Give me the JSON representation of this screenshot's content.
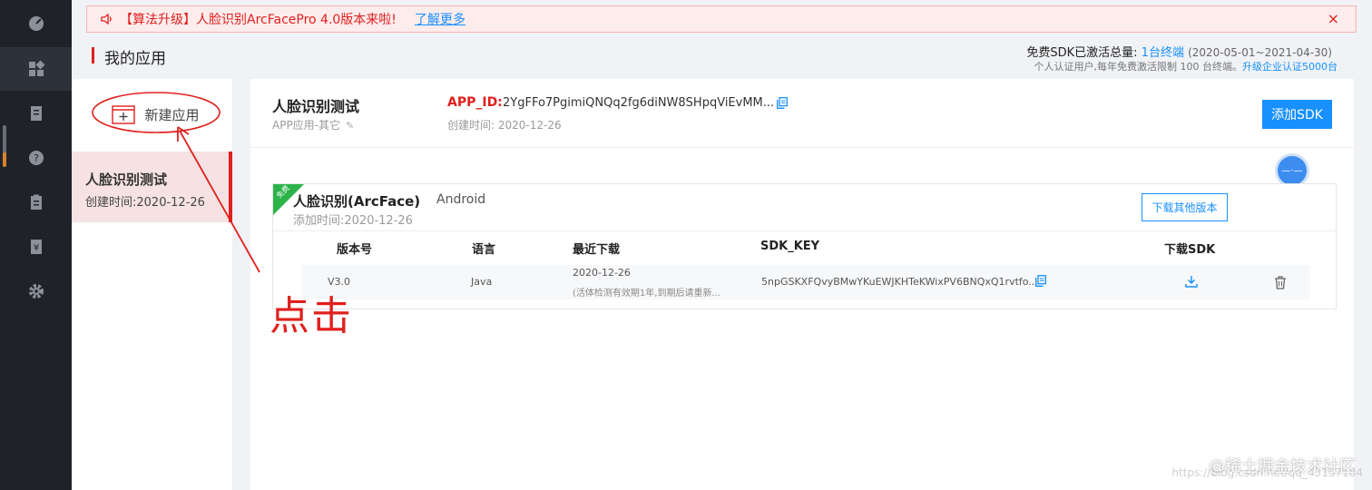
{
  "banner": {
    "text": "【算法升级】人脸识别ArcFacePro 4.0版本来啦!",
    "link": "了解更多",
    "close": "×"
  },
  "header": {
    "title": "我的应用",
    "quota_label": "免费SDK已激活总量:",
    "quota_count": "1台终端",
    "quota_range": "(2020-05-01~2021-04-30)",
    "quota_note": "个人认证用户,每年免费激活限制 100 台终端。",
    "upgrade_link": "升级企业认证5000台"
  },
  "sidebar": {
    "new_app": "新建应用",
    "apps": [
      {
        "name": "人脸识别测试",
        "created": "创建时间:2020-12-26"
      }
    ]
  },
  "app": {
    "name": "人脸识别测试",
    "type": "APP应用-其它",
    "appid_label": "APP_ID:",
    "appid_value": "2YgFFo7PgimiQNQq2fg6diNW8SHpqViEvMM...",
    "created": "创建时间: 2020-12-26",
    "add_sdk": "添加SDK"
  },
  "sdk": {
    "ribbon": "免费",
    "name": "人脸识别(ArcFace)",
    "platform": "Android",
    "added": "添加时间:2020-12-26",
    "download_other": "下载其他版本",
    "columns": [
      "版本号",
      "语言",
      "最近下载",
      "SDK_KEY",
      "下载SDK"
    ],
    "rows": [
      {
        "version": "V3.0",
        "language": "Java",
        "last_download": "2020-12-26",
        "last_download_note": "(活体检测有效期1年,到期后请重新...",
        "sdk_key": "5npGSKXFQvyBMwYKuEWJKHTeKWixPV6BNQxQ1rvtfo..."
      }
    ]
  },
  "annotation": {
    "click": "点击"
  },
  "watermark": {
    "brand": "@稀土掘金技术社区",
    "faint": "https://blog.csdn.net/qq_43157184"
  },
  "colors": {
    "accent": "#1890ff",
    "alert": "#e0201e",
    "nav_bg": "#1f2329",
    "ribbon": "#2cb34a"
  }
}
